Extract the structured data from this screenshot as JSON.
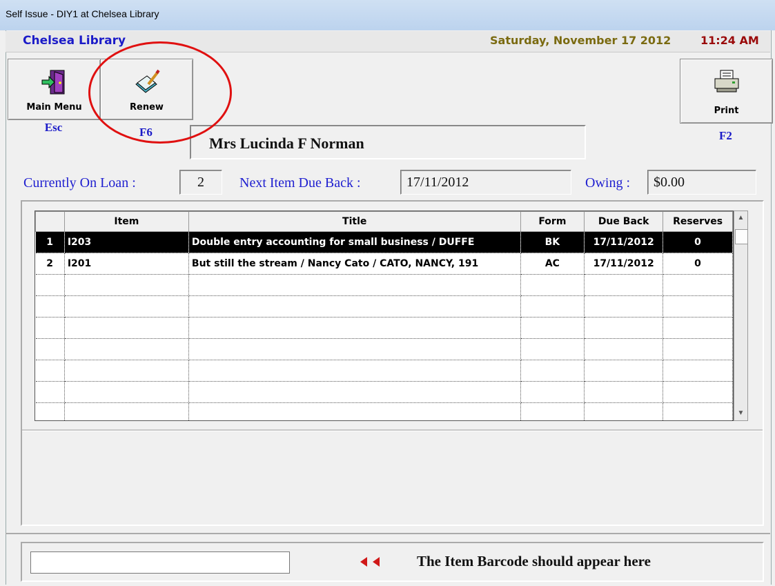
{
  "window": {
    "title": "Self Issue - DIY1 at Chelsea Library"
  },
  "header": {
    "library": "Chelsea Library",
    "date": "Saturday, November 17 2012",
    "time": "11:24 AM"
  },
  "toolbar": {
    "main_menu": {
      "label": "Main Menu",
      "key": "Esc",
      "icon": "exit-door-icon"
    },
    "renew": {
      "label": "Renew",
      "key": "F6",
      "icon": "renew-book-icon"
    },
    "print": {
      "label": "Print",
      "key": "F2",
      "icon": "printer-icon"
    }
  },
  "patron": {
    "name": "Mrs Lucinda F Norman"
  },
  "summary": {
    "on_loan_label": "Currently On Loan :",
    "on_loan": "2",
    "due_label": "Next Item Due Back :",
    "due": "17/11/2012",
    "owing_label": "Owing :",
    "owing": "$0.00"
  },
  "table": {
    "headers": [
      "",
      "Item",
      "Title",
      "Form",
      "Due Back",
      "Reserves"
    ],
    "rows": [
      {
        "num": "1",
        "item": "I203",
        "title": "Double entry accounting for small business / DUFFE",
        "form": "BK",
        "due": "17/11/2012",
        "reserves": "0",
        "selected": true
      },
      {
        "num": "2",
        "item": "I201",
        "title": "But still the stream / Nancy Cato / CATO, NANCY, 191",
        "form": "AC",
        "due": "17/11/2012",
        "reserves": "0",
        "selected": false
      }
    ],
    "empty_rows": 7
  },
  "footer": {
    "barcode_value": "",
    "hint": "The Item Barcode should appear here"
  },
  "colors": {
    "label_blue": "#2020d0",
    "highlight_circle": "#e01010",
    "date": "#7a6a10",
    "time": "#9a0a0a"
  }
}
